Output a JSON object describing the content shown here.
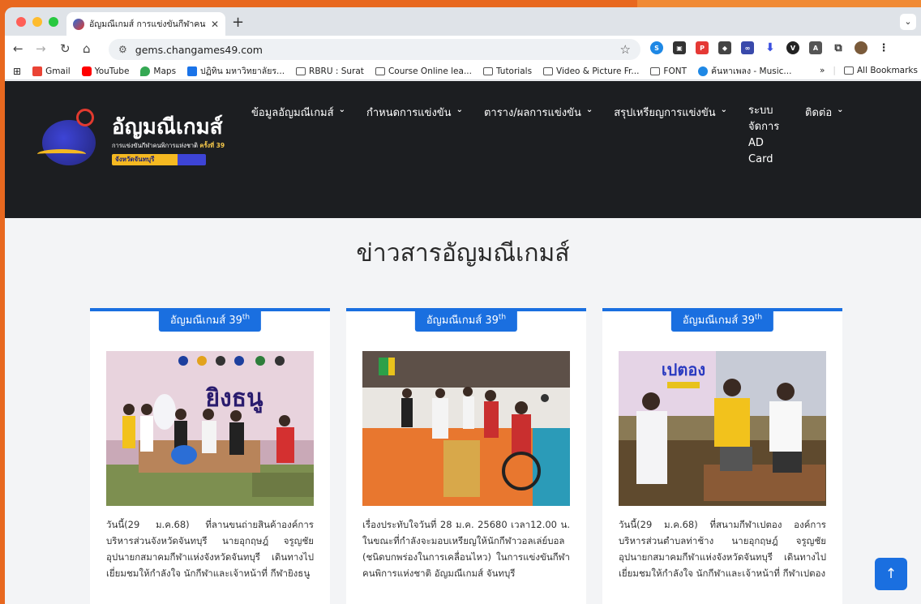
{
  "browser": {
    "tab_title": "อัญมณีเกมส์ การแข่งขันกีฬาคนพิก",
    "url": "gems.changames49.com",
    "bookmarks": [
      "Gmail",
      "YouTube",
      "Maps",
      "ปฏิทิน มหาวิทยาลัยร...",
      "RBRU : Surat",
      "Course Online lea...",
      "Tutorials",
      "Video & Picture Fr...",
      "FONT",
      "ค้นหาเพลง - Music..."
    ],
    "bookmarks_more": "»",
    "all_bookmarks": "All Bookmarks"
  },
  "site": {
    "logo_title": "อัญมณีเกมส์",
    "logo_sub": "การแข่งขันกีฬาคนพิการแห่งชาติ",
    "logo_sub_bold": "ครั้งที่ 39",
    "logo_province": "จังหวัดจันทบุรี",
    "nav": [
      {
        "label": "ข้อมูลอัญมณีเกมส์"
      },
      {
        "label": "กำหนดการแข่งขัน"
      },
      {
        "label": "ตาราง/ผลการแข่งขัน"
      },
      {
        "label": "สรุปเหรียญการแข่งขัน"
      },
      {
        "label": "ระบบ จัดการ AD Card"
      },
      {
        "label": "ติดต่อ"
      }
    ]
  },
  "section_title": "ข่าวสารอัญมณีเกมส์",
  "cards": [
    {
      "badge": "อัญมณีเกมส์ 39",
      "badge_sup": "th",
      "sign": "ยิงธนู",
      "text": "วันนี้(29 ม.ค.68) ที่ลานขนถ่ายสินค้าองค์การบริหารส่วนจังหวัดจันทบุรี นายอุกฤษฎ์ จรูญชัย อุปนายกสมาคมกีฬาแห่งจังหวัดจันทบุรี เดินทางไปเยี่ยมชมให้กำลังใจ นักกีฬาและเจ้าหน้าที่ กีฬายิงธนู"
    },
    {
      "badge": "อัญมณีเกมส์ 39",
      "badge_sup": "th",
      "text": "เรื่องประทับใจวันที่ 28 ม.ค. 25680 เวลา12.00 น. ในขณะที่กำลังจะมอบเหรียญให้นักกีฬาวอลเล่ย์บอล (ชนิดบกพร่องในการเคลื่อนไหว) ในการแข่งขันกีฬาคนพิการแห่งชาติ อัญมณีเกมส์ จันทบุรี"
    },
    {
      "badge": "อัญมณีเกมส์ 39",
      "badge_sup": "th",
      "sign": "เปตอง",
      "text": "วันนี้(29 ม.ค.68) ที่สนามกีฬาเปตอง องค์การบริหารส่วนตำบลท่าช้าง นายอุกฤษฎ์ จรูญชัย อุปนายกสมาคมกีฬาแห่งจังหวัดจันทบุรี เดินทางไปเยี่ยมชมให้กำลังใจ นักกีฬาและเจ้าหน้าที่ กีฬาเปตอง"
    }
  ],
  "colors": {
    "accent": "#1a6fe0",
    "header_bg": "#1c1e21"
  }
}
